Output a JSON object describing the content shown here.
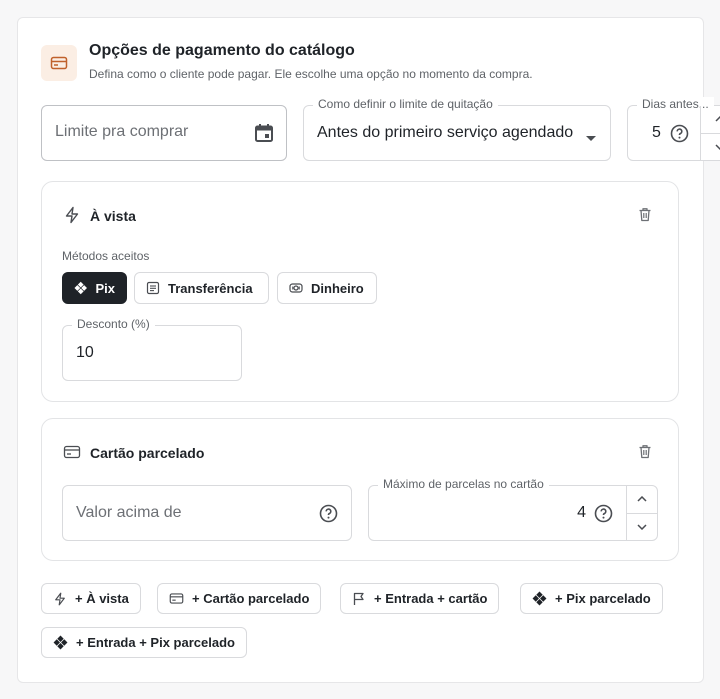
{
  "header": {
    "icon": "credit-card-icon",
    "title": "Opções de pagamento do catálogo",
    "subtitle": "Defina como o cliente pode pagar. Ele escolhe uma opção no momento da compra."
  },
  "limit_field": {
    "placeholder": "Limite pra comprar",
    "icon": "calendar-icon"
  },
  "settle_select": {
    "label": "Como definir o limite de quitação",
    "value": "Antes do primeiro serviço agendado"
  },
  "days_field": {
    "label": "Dias antes...",
    "value": "5"
  },
  "cash_card": {
    "title": "À vista",
    "icon": "lightning-icon",
    "methods_label": "Métodos aceitos",
    "methods": [
      {
        "label": "Pix",
        "icon": "pix-icon",
        "active": true
      },
      {
        "label": "Transferência",
        "icon": "receipt-icon",
        "active": false
      },
      {
        "label": "Dinheiro",
        "icon": "banknote-icon",
        "active": false
      }
    ],
    "discount_label": "Desconto (%)",
    "discount_value": "10"
  },
  "installment_card": {
    "title": "Cartão parcelado",
    "icon": "credit-card-icon",
    "min_value_placeholder": "Valor acima de",
    "max_installments_label": "Máximo de parcelas no cartão",
    "max_installments_value": "4"
  },
  "add_buttons": [
    {
      "label": "+ À vista",
      "icon": "lightning-icon"
    },
    {
      "label": "+ Cartão parcelado",
      "icon": "credit-card-icon"
    },
    {
      "label": "+ Entrada + cartão",
      "icon": "flag-icon"
    },
    {
      "label": "+ Pix parcelado",
      "icon": "pix-icon"
    },
    {
      "label": "+ Entrada + Pix parcelado",
      "icon": "pix-icon"
    }
  ],
  "colors": {
    "accent_bg": "#fbeee4",
    "accent_icon": "#c0612b",
    "dark_chip": "#1f2328",
    "border": "#d9dadd"
  }
}
